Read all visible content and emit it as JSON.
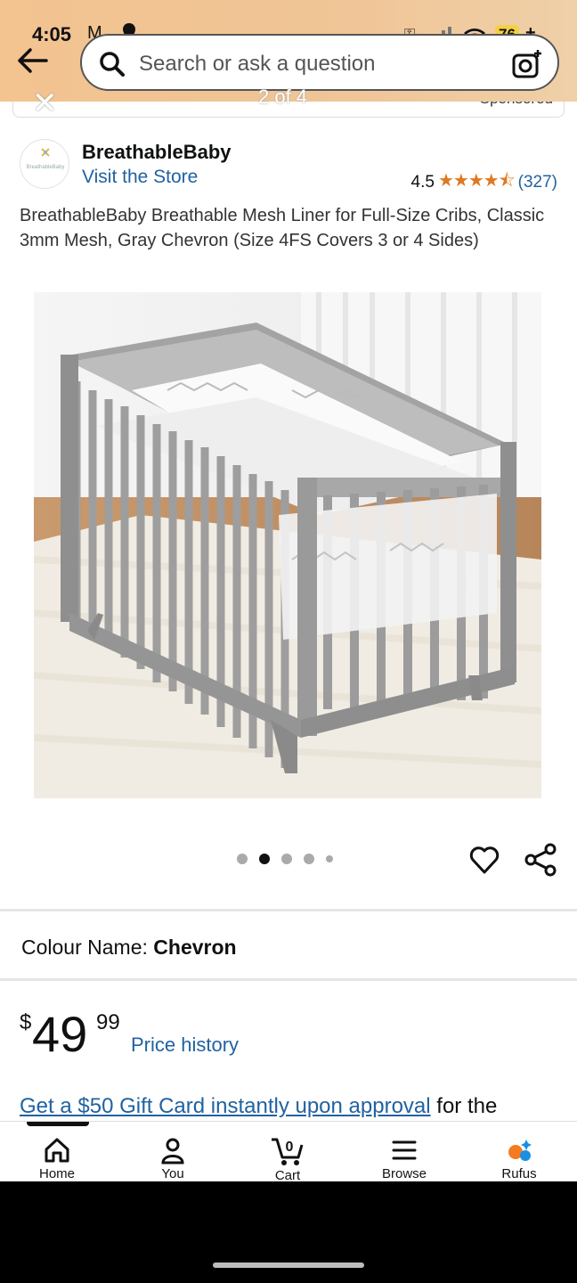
{
  "status_bar": {
    "time": "4:05",
    "battery": "76",
    "charging": "+"
  },
  "search": {
    "placeholder": "Search or ask a question"
  },
  "ad_strip": {
    "sponsored_label": "Sponsored",
    "counter": "2 of 4"
  },
  "brand": {
    "name": "BreathableBaby",
    "logo_text": "BreathableBaby",
    "visit_store": "Visit the Store"
  },
  "rating": {
    "value": "4.5",
    "stars": 4.5,
    "count": "(327)"
  },
  "product": {
    "title": "BreathableBaby Breathable Mesh Liner for Full-Size Cribs, Classic 3mm Mesh, Gray Chevron (Size 4FS Covers 3 or 4 Sides)",
    "image_count": 5,
    "active_image": 2
  },
  "colour": {
    "label": "Colour Name:",
    "value": "Chevron"
  },
  "price": {
    "currency": "$",
    "whole": "49",
    "fraction": "99",
    "history_link": "Price history"
  },
  "promo": {
    "link": "Get a $50 Gift Card instantly upon approval",
    "rest": " for the"
  },
  "nav": {
    "items": [
      {
        "label": "Home",
        "icon": "home-icon"
      },
      {
        "label": "You",
        "icon": "user-icon"
      },
      {
        "label": "Cart",
        "icon": "cart-icon",
        "badge": "0"
      },
      {
        "label": "Browse",
        "icon": "menu-icon"
      },
      {
        "label": "Rufus",
        "icon": "rufus-icon"
      }
    ]
  },
  "colors": {
    "accent_link": "#2162a1",
    "star": "#de7921",
    "header": "#f2c18e"
  }
}
